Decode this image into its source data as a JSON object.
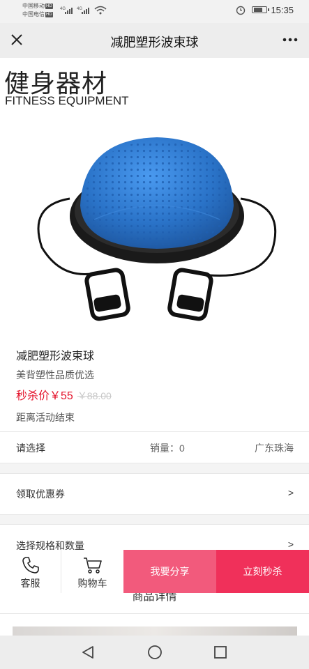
{
  "status_bar": {
    "carrier_1": "中国移动",
    "carrier_2": "中国电信",
    "hd_badge": "HD",
    "network": "4G",
    "time": "15:35"
  },
  "title_bar": {
    "title": "减肥塑形波束球"
  },
  "banner": {
    "title_cn": "健身器材",
    "title_en": "FITNESS EQUIPMENT"
  },
  "product": {
    "name": "减肥塑形波束球",
    "subtitle": "美背塑性品质优选",
    "price_label": "秒杀价￥55",
    "original_price": "￥88.00",
    "countdown_label": "距离活动结束",
    "image_color": "#2a73c8"
  },
  "selection_row": {
    "label": "请选择",
    "sales": "销量：0",
    "region": "广东珠海"
  },
  "coupon_row": {
    "label": "领取优惠券",
    "arrow": ">"
  },
  "spec_row": {
    "label": "选择规格和数量",
    "arrow": ">"
  },
  "detail": {
    "title": "商品详情"
  },
  "action_bar": {
    "service": "客服",
    "cart": "购物车",
    "share": "我要分享",
    "buy": "立刻秒杀",
    "share_color": "#f25a7c",
    "buy_color": "#f0305a"
  },
  "nav_bar": {
    "icons": [
      "back-triangle-icon",
      "home-circle-icon",
      "recent-square-icon"
    ]
  }
}
